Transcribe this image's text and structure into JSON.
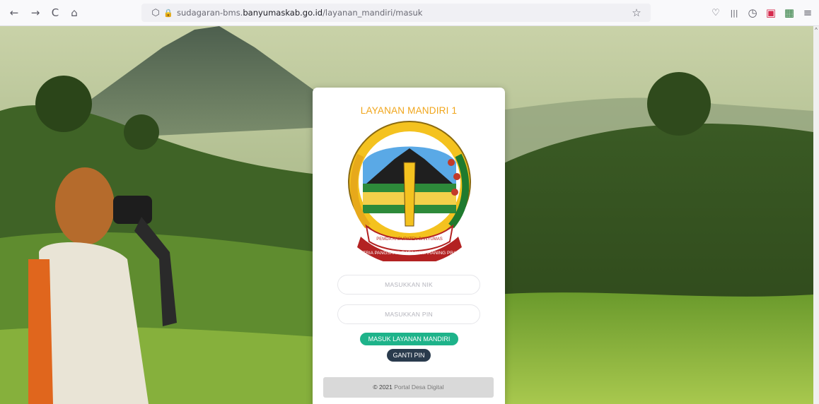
{
  "browser": {
    "url_prefix": "sudagaran-bms.",
    "url_domain": "banyumaskab.go.id",
    "url_path": "/layanan_mandiri/masuk",
    "icons": {
      "back": "←",
      "forward": "→",
      "reload": "C",
      "home": "⌂",
      "shield": "⬡",
      "lock": "🔒",
      "star": "☆",
      "pocket": "♡",
      "library": "|||",
      "history": "◷",
      "ext1": "▣",
      "ext2": "▦",
      "menu": "≡"
    }
  },
  "card": {
    "title": "LAYANAN MANDIRI 1",
    "emblem_text_top": "PEMDA KABUPATEN BANYUMAS",
    "emblem_motto": "SATRIA PANGSANG RASA WIWARANING PRAJA",
    "nik_placeholder": "MASUKKAN NIK",
    "pin_placeholder": "MASUKKAN PIN",
    "login_button": "MASUK LAYANAN MANDIRI",
    "change_pin_button": "GANTI PIN",
    "footer_prefix": "© 2021 ",
    "footer_link": "Portal Desa Digital"
  },
  "colors": {
    "accent_title": "#f0a51b",
    "login_button": "#1eb38a",
    "pin_button": "#2a3b4d"
  }
}
